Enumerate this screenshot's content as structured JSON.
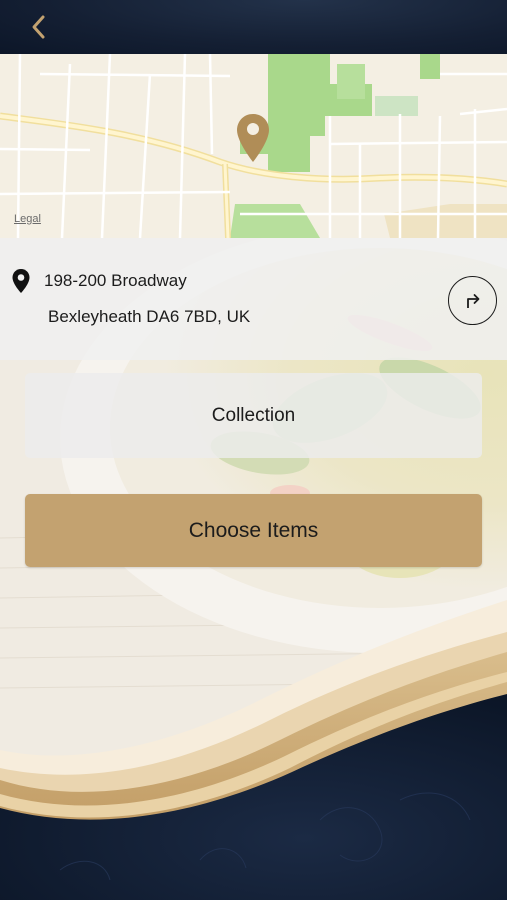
{
  "topbar": {
    "back_icon": "chevron-left-icon",
    "icon_color": "#c3a270"
  },
  "map": {
    "legal_label": "Legal",
    "marker_icon": "map-marker-icon",
    "marker_color": "#b08d57"
  },
  "address": {
    "pin_icon": "location-pin-icon",
    "line1": "198-200 Broadway",
    "line2": "Bexleyheath DA6 7BD, UK",
    "directions_icon": "directions-arrow-icon"
  },
  "actions": {
    "collection_label": "Collection",
    "choose_items_label": "Choose Items"
  },
  "colors": {
    "accent": "#c3a270",
    "navy": "#0d1a2e"
  }
}
